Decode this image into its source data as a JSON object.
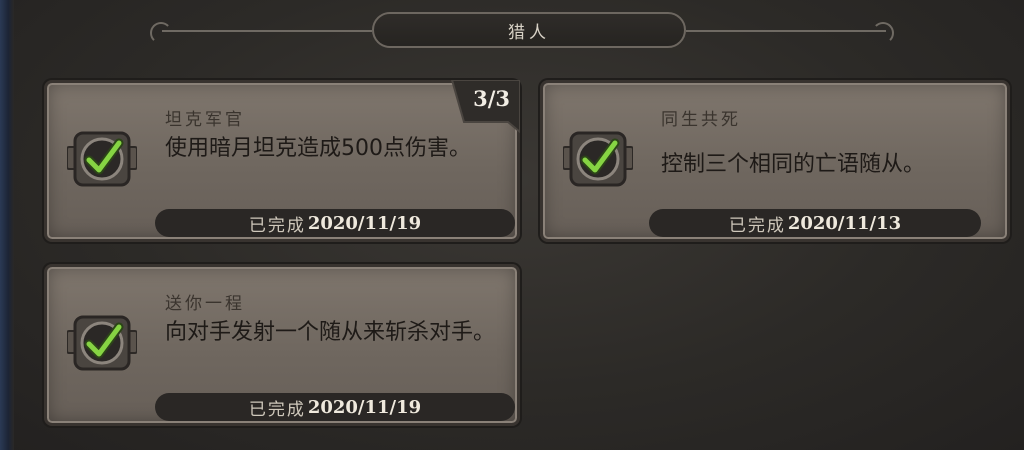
{
  "header": {
    "title": "猎人"
  },
  "achievements": [
    {
      "title": "坦克军官",
      "description": "使用暗月坦克造成500点伤害。",
      "progress": "3/3",
      "completed_label": "已完成",
      "completed_date": "2020/11/19"
    },
    {
      "title": "同生共死",
      "description": "控制三个相同的亡语随从。",
      "completed_label": "已完成",
      "completed_date": "2020/11/13"
    },
    {
      "title": "送你一程",
      "description": "向对手发射一个随从来斩杀对手。",
      "completed_label": "已完成",
      "completed_date": "2020/11/19"
    }
  ],
  "icons": {
    "status": "checkmark-badge-icon"
  },
  "colors": {
    "check_green": "#7fd13b",
    "card_bg": "#766d64",
    "bar_bg": "#2a2725"
  }
}
